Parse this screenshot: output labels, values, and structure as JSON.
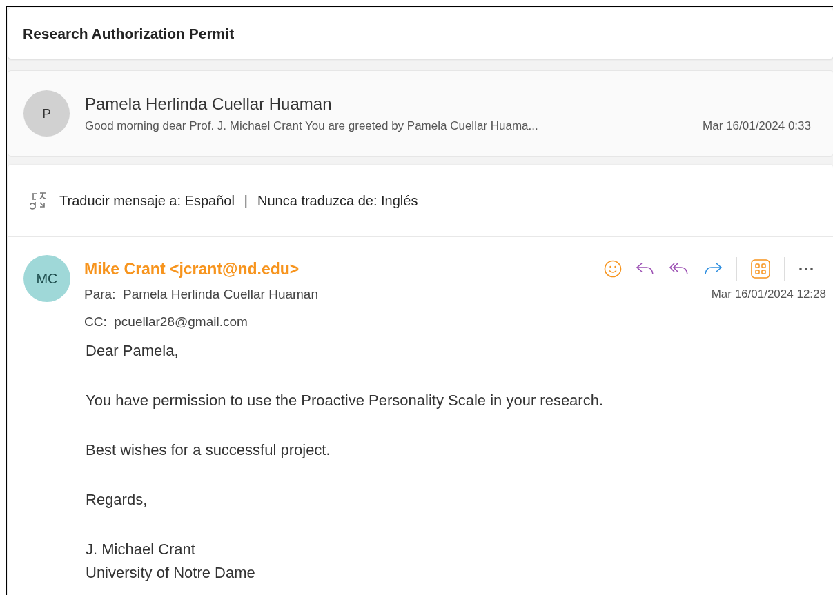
{
  "subject": "Research Authorization Permit",
  "collapsed_message": {
    "avatar": "P",
    "sender": "Pamela Herlinda Cuellar Huaman",
    "preview": "Good morning dear Prof. J. Michael Crant You are greeted by Pamela Cuellar Huama...",
    "date": "Mar 16/01/2024 0:33"
  },
  "translate_bar": {
    "translate": "Traducir mensaje a: Español",
    "separator": "|",
    "never": "Nunca traduzca de: Inglés"
  },
  "message": {
    "avatar": "MC",
    "sender": "Mike Crant <jcrant@nd.edu>",
    "to_label": "Para:",
    "to": "Pamela Herlinda Cuellar Huaman",
    "cc_label": "CC:",
    "cc": "pcuellar28@gmail.com",
    "date": "Mar 16/01/2024 12:28",
    "body": [
      {
        "kind": "para",
        "text": "Dear Pamela,"
      },
      {
        "kind": "para",
        "text": "You have permission to use the Proactive Personality Scale in your research."
      },
      {
        "kind": "para",
        "text": "Best wishes for a successful project."
      },
      {
        "kind": "para",
        "text": "Regards,"
      },
      {
        "kind": "signature",
        "lines": [
          "J. Michael Crant",
          "University of Notre Dame"
        ]
      }
    ]
  }
}
